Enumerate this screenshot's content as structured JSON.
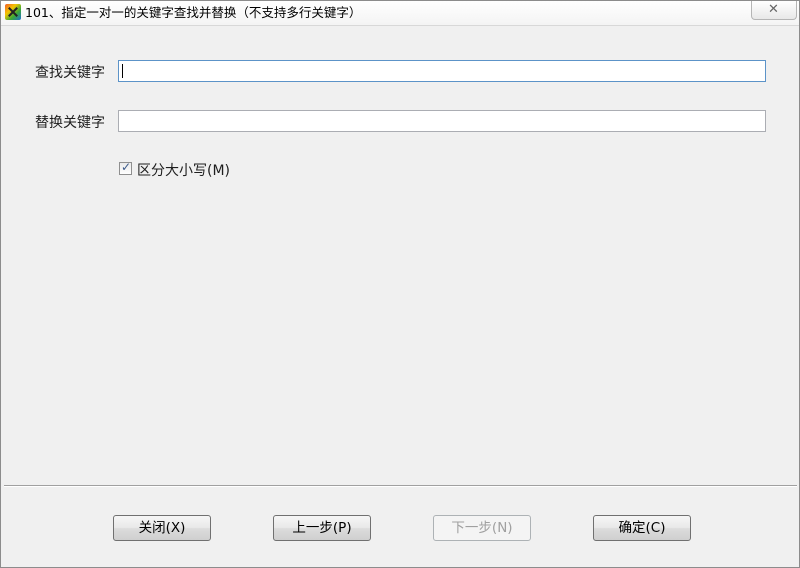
{
  "window": {
    "title": "101、指定一对一的关键字查找并替换（不支持多行关键字）",
    "close_glyph": "✕"
  },
  "form": {
    "find_label": "查找关键字",
    "find_value": "",
    "replace_label": "替换关键字",
    "replace_value": "",
    "case_sensitive_label": "区分大小写(M)",
    "case_sensitive_checked": true,
    "check_glyph": "✓"
  },
  "buttons": {
    "close_label": "关闭(X)",
    "prev_label": "上一步(P)",
    "next_label": "下一步(N)",
    "next_disabled": true,
    "ok_label": "确定(C)"
  },
  "icons": {
    "app": "tools-app-icon",
    "close": "close-icon",
    "check": "checkmark-icon"
  }
}
